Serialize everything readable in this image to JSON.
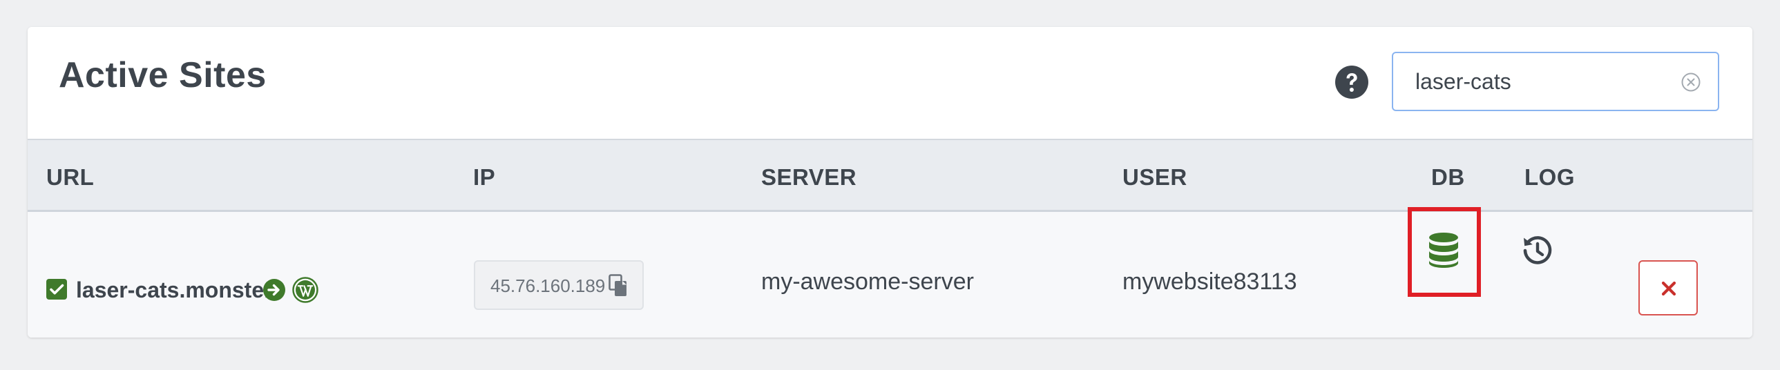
{
  "header": {
    "title": "Active Sites",
    "help_icon": "question-circle-icon"
  },
  "search": {
    "value": "laser-cats",
    "clear_icon": "clear-circle-icon"
  },
  "table": {
    "columns": [
      "URL",
      "IP",
      "SERVER",
      "USER",
      "DB",
      "LOG"
    ],
    "rows": [
      {
        "checked": true,
        "url": "laser-cats.monster",
        "ip": "45.76.160.189",
        "server": "my-awesome-server",
        "user": "mywebsite83113",
        "db_icon": "database-icon",
        "log_icon": "history-icon",
        "delete_icon": "close-icon"
      }
    ]
  },
  "colors": {
    "accent_green": "#3f7a2b",
    "danger": "#d9534f",
    "highlight": "#e01f26",
    "search_border": "#8ab4f0",
    "header_bg": "#e9ecf0"
  }
}
